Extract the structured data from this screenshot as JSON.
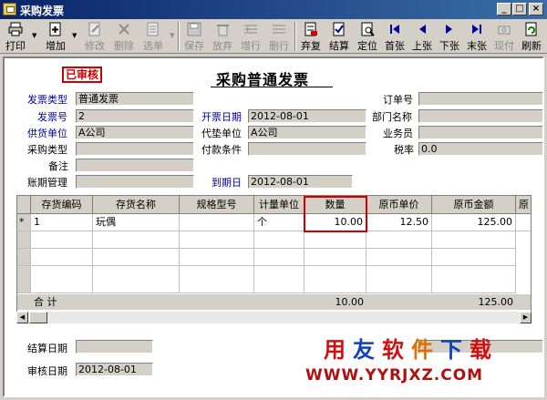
{
  "window": {
    "title": "采购发票"
  },
  "toolbar": [
    {
      "id": "print",
      "label": "打印",
      "icon": "printer-icon",
      "enabled": true
    },
    {
      "id": "add",
      "label": "增加",
      "icon": "add-doc-icon",
      "enabled": true
    },
    {
      "id": "modify",
      "label": "修改",
      "icon": "edit-icon",
      "enabled": false
    },
    {
      "id": "delete",
      "label": "删除",
      "icon": "delete-icon",
      "enabled": false
    },
    {
      "id": "select",
      "label": "选单",
      "icon": "select-doc-icon",
      "enabled": false
    },
    {
      "id": "save",
      "label": "保存",
      "icon": "save-icon",
      "enabled": false
    },
    {
      "id": "discard",
      "label": "放弃",
      "icon": "discard-icon",
      "enabled": false
    },
    {
      "id": "addrow",
      "label": "增行",
      "icon": "add-row-icon",
      "enabled": false
    },
    {
      "id": "delrow",
      "label": "删行",
      "icon": "delete-row-icon",
      "enabled": false
    },
    {
      "id": "unaudit",
      "label": "弃复",
      "icon": "unaudit-icon",
      "enabled": true
    },
    {
      "id": "settle",
      "label": "结算",
      "icon": "settle-icon",
      "enabled": true
    },
    {
      "id": "locate",
      "label": "定位",
      "icon": "locate-icon",
      "enabled": true
    },
    {
      "id": "first",
      "label": "首张",
      "icon": "first-icon",
      "enabled": true
    },
    {
      "id": "prev",
      "label": "上张",
      "icon": "prev-icon",
      "enabled": true
    },
    {
      "id": "next",
      "label": "下张",
      "icon": "next-icon",
      "enabled": true
    },
    {
      "id": "last",
      "label": "末张",
      "icon": "last-icon",
      "enabled": true
    },
    {
      "id": "pay",
      "label": "现付",
      "icon": "cash-pay-icon",
      "enabled": false
    },
    {
      "id": "refresh",
      "label": "刷新",
      "icon": "refresh-icon",
      "enabled": true
    }
  ],
  "form": {
    "stamp": "已审核",
    "title": "采购普通发票",
    "labels": {
      "invoice_type": "发票类型",
      "invoice_no": "发票号",
      "supplier": "供货单位",
      "purchase_type": "采购类型",
      "remark": "备注",
      "account_period": "账期管理",
      "invoice_date": "开票日期",
      "agent_unit": "代垫单位",
      "payment_terms": "付款条件",
      "due_date": "到期日",
      "order_no": "订单号",
      "department": "部门名称",
      "salesman": "业务员",
      "tax_rate": "税率"
    },
    "values": {
      "invoice_type": "普通发票",
      "invoice_no": "2",
      "supplier": "A公司",
      "purchase_type": "",
      "remark": "",
      "account_period": "",
      "invoice_date": "2012-08-01",
      "agent_unit": "A公司",
      "payment_terms": "",
      "due_date": "2012-08-01",
      "order_no": "",
      "department": "",
      "salesman": "",
      "tax_rate": "0.0"
    }
  },
  "grid": {
    "columns": [
      "存货编码",
      "存货名称",
      "规格型号",
      "计量单位",
      "数量",
      "原币单价",
      "原币金额",
      "原"
    ],
    "rows": [
      {
        "marker": "*",
        "code": "1",
        "name": "玩偶",
        "spec": "",
        "unit": "个",
        "qty": "10.00",
        "price": "12.50",
        "amount": "125.00"
      }
    ],
    "sum_label": "合  计",
    "sum_qty": "10.00",
    "sum_amount": "125.00"
  },
  "footer": {
    "settle_date_label": "结算日期",
    "settle_date": "",
    "audit_date_label": "审核日期",
    "audit_date": "2012-08-01"
  },
  "watermark": {
    "cn": [
      "用",
      "友",
      "软",
      "件",
      "下",
      "载"
    ],
    "colors": [
      "#d01010",
      "#1040c0",
      "#d01010",
      "#e07000",
      "#1040c0",
      "#d01010"
    ],
    "url": "WWW.YYRJXZ.COM",
    "url_color": "#b01010"
  }
}
